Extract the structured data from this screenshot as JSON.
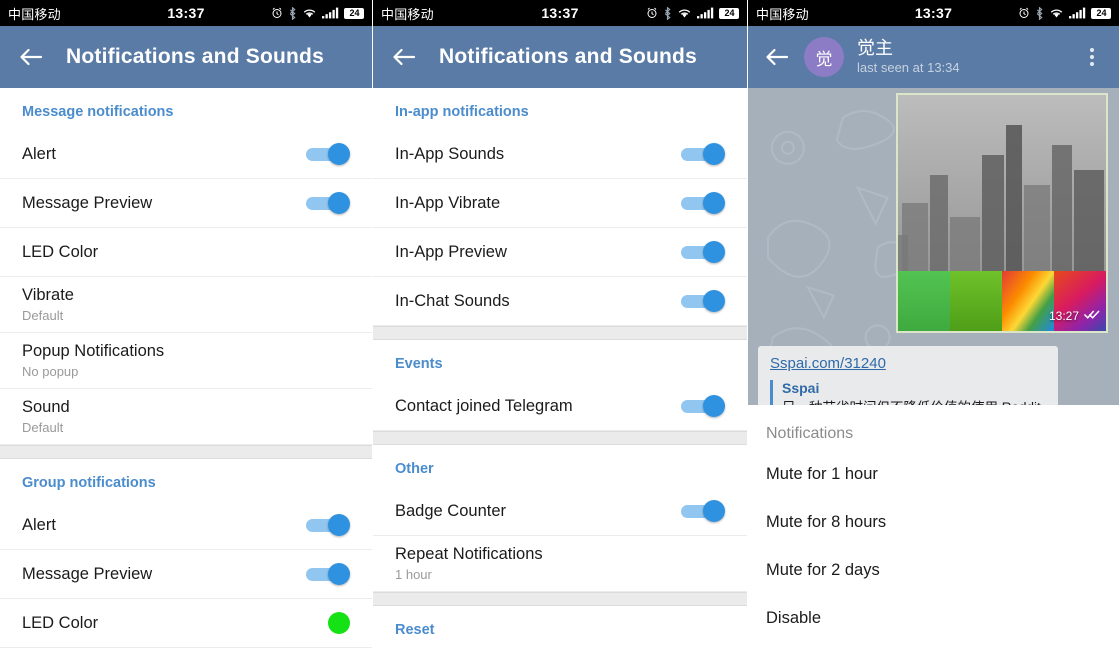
{
  "statusbar": {
    "carrier": "中国移动",
    "time": "13:37",
    "battery": "24",
    "icons": [
      "alarm-icon",
      "bluetooth-icon",
      "wifi-icon",
      "signal-icon",
      "battery-icon"
    ]
  },
  "panel1": {
    "appbar": {
      "back": "back-arrow-icon",
      "title": "Notifications and Sounds"
    },
    "sections": [
      {
        "header": "Message notifications",
        "rows": [
          {
            "title": "Alert",
            "sub": "",
            "control": "toggle-on"
          },
          {
            "title": "Message Preview",
            "sub": "",
            "control": "toggle-on"
          },
          {
            "title": "LED Color",
            "sub": "",
            "control": "none"
          },
          {
            "title": "Vibrate",
            "sub": "Default",
            "control": "none"
          },
          {
            "title": "Popup Notifications",
            "sub": "No popup",
            "control": "none"
          },
          {
            "title": "Sound",
            "sub": "Default",
            "control": "none"
          }
        ]
      },
      {
        "header": "Group notifications",
        "rows": [
          {
            "title": "Alert",
            "sub": "",
            "control": "toggle-on"
          },
          {
            "title": "Message Preview",
            "sub": "",
            "control": "toggle-on"
          },
          {
            "title": "LED Color",
            "sub": "",
            "control": "led-green"
          }
        ]
      }
    ]
  },
  "panel2": {
    "appbar": {
      "back": "back-arrow-icon",
      "title": "Notifications and Sounds"
    },
    "sections": [
      {
        "header": "In-app notifications",
        "rows": [
          {
            "title": "In-App Sounds",
            "sub": "",
            "control": "toggle-on"
          },
          {
            "title": "In-App Vibrate",
            "sub": "",
            "control": "toggle-on"
          },
          {
            "title": "In-App Preview",
            "sub": "",
            "control": "toggle-on"
          },
          {
            "title": "In-Chat Sounds",
            "sub": "",
            "control": "toggle-on"
          }
        ]
      },
      {
        "header": "Events",
        "rows": [
          {
            "title": "Contact joined Telegram",
            "sub": "",
            "control": "toggle-on"
          }
        ]
      },
      {
        "header": "Other",
        "rows": [
          {
            "title": "Badge Counter",
            "sub": "",
            "control": "toggle-on"
          },
          {
            "title": "Repeat Notifications",
            "sub": "1 hour",
            "control": "none"
          }
        ]
      },
      {
        "header": "Reset",
        "rows": []
      }
    ]
  },
  "panel3": {
    "appbar": {
      "back": "back-arrow-icon",
      "avatar_initial": "觉",
      "avatar_color": "#8b7cc5",
      "name": "觉主",
      "status": "last seen at 13:34",
      "menu": "kebab-menu-icon"
    },
    "message": {
      "time": "13:27",
      "read_receipt": "double-check-icon"
    },
    "link_preview": {
      "url": "Sspai.com/31240",
      "site": "Sspai",
      "description": "另一种节省时间但不降低价值的使用 Reddit 的..."
    },
    "sheet": {
      "title": "Notifications",
      "items": [
        "Mute for 1 hour",
        "Mute for 8 hours",
        "Mute for 2 days",
        "Disable"
      ]
    }
  },
  "colors": {
    "appbar_blue": "#5a7ba6",
    "accent_blue": "#4a8ccc",
    "toggle_thumb": "#2f92e0",
    "toggle_track": "#90c6f0",
    "led_green": "#15e215",
    "chat_bg": "#a6b0bb"
  }
}
